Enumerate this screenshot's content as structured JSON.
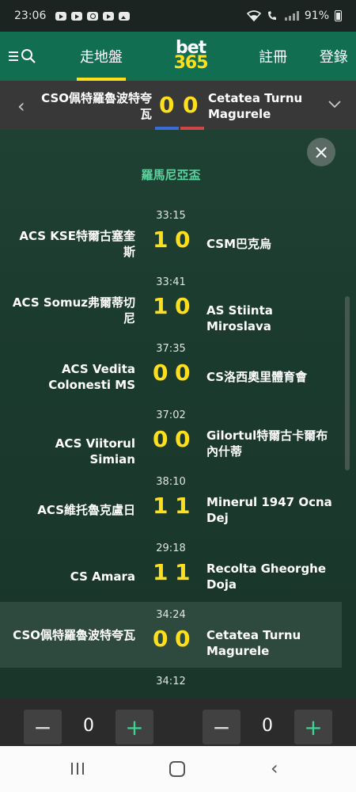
{
  "status_bar": {
    "time": "23:06",
    "battery": "91%"
  },
  "header": {
    "logo_top": "bet",
    "logo_bottom": "365",
    "nav_live": "走地盤",
    "nav_register": "註冊",
    "nav_login": "登錄"
  },
  "match_header": {
    "home": "CSO佩特羅魯波特夸瓦",
    "away": "Cetatea Turnu Magurele",
    "home_score": "0",
    "away_score": "0"
  },
  "league": "羅馬尼亞盃",
  "matches": [
    {
      "time": "33:15",
      "home": "ACS KSE特爾古塞奎斯",
      "away": "CSM巴克烏",
      "home_score": "1",
      "away_score": "0"
    },
    {
      "time": "33:41",
      "home": "ACS Somuz弗爾蒂切尼",
      "away": "AS Stiinta Miroslava",
      "home_score": "1",
      "away_score": "0"
    },
    {
      "time": "37:35",
      "home": "ACS Vedita Colonesti MS",
      "away": "CS洛西奧里體育會",
      "home_score": "0",
      "away_score": "0"
    },
    {
      "time": "37:02",
      "home": "ACS Viitorul Simian",
      "away": "Gilortul特爾古卡爾布內什蒂",
      "home_score": "0",
      "away_score": "0"
    },
    {
      "time": "38:10",
      "home": "ACS維托魯克盧日",
      "away": "Minerul 1947 Ocna Dej",
      "home_score": "1",
      "away_score": "1"
    },
    {
      "time": "29:18",
      "home": "CS Amara",
      "away": "Recolta Gheorghe Doja",
      "home_score": "1",
      "away_score": "1"
    },
    {
      "time": "34:24",
      "home": "CSO佩特羅魯波特夸瓦",
      "away": "Cetatea Turnu Magurele",
      "home_score": "0",
      "away_score": "0"
    },
    {
      "time": "34:12",
      "home": "",
      "away": "",
      "home_score": "",
      "away_score": ""
    }
  ],
  "controls": {
    "minus_label": "−",
    "plus_label": "+",
    "left_value": "0",
    "right_value": "0"
  },
  "icons": {
    "close": "×",
    "prev": "‹",
    "down": "﹀",
    "back": "‹"
  }
}
